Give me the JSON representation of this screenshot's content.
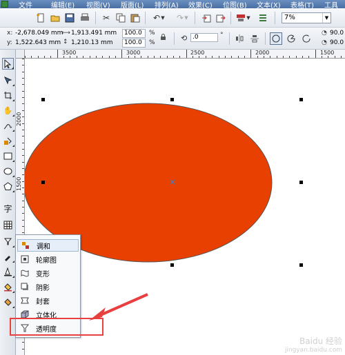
{
  "menubar": {
    "items": [
      "文件",
      "编辑(E)",
      "视图(V)",
      "版面(L)",
      "排列(A)",
      "效果(C)",
      "位图(B)",
      "文本(X)",
      "表格(T)",
      "工具"
    ]
  },
  "toolbar": {
    "zoom": "7%"
  },
  "propbar": {
    "x_label": "x:",
    "x_value": "-2,678.049 mm",
    "y_label": "y:",
    "y_value": "1,522.643 mm",
    "w_value": "1,913.491 mm",
    "h_value": "1,210.13 mm",
    "scale_w": "100.0",
    "scale_h": "100.0",
    "percent": "%",
    "rotation": ".0",
    "angle1": "90.0",
    "angle2": "90.0"
  },
  "rulers": {
    "h_labels": [
      "3500",
      "3000",
      "2500",
      "2000",
      "1500"
    ],
    "v_labels": [
      "2000",
      "1500"
    ]
  },
  "flyout": {
    "items": [
      {
        "label": "调和",
        "icon": "blend-icon"
      },
      {
        "label": "轮廓图",
        "icon": "contour-icon"
      },
      {
        "label": "变形",
        "icon": "distort-icon"
      },
      {
        "label": "阴影",
        "icon": "shadow-icon"
      },
      {
        "label": "封套",
        "icon": "envelope-icon"
      },
      {
        "label": "立体化",
        "icon": "extrude-icon"
      },
      {
        "label": "透明度",
        "icon": "transparency-icon"
      }
    ]
  },
  "watermark": {
    "text": "Baidu 经验",
    "sub": "jingyan.baidu.com"
  },
  "colors": {
    "ellipse_fill": "#e84000",
    "highlight_box": "#e8403f",
    "arrow": "#e8403f"
  }
}
